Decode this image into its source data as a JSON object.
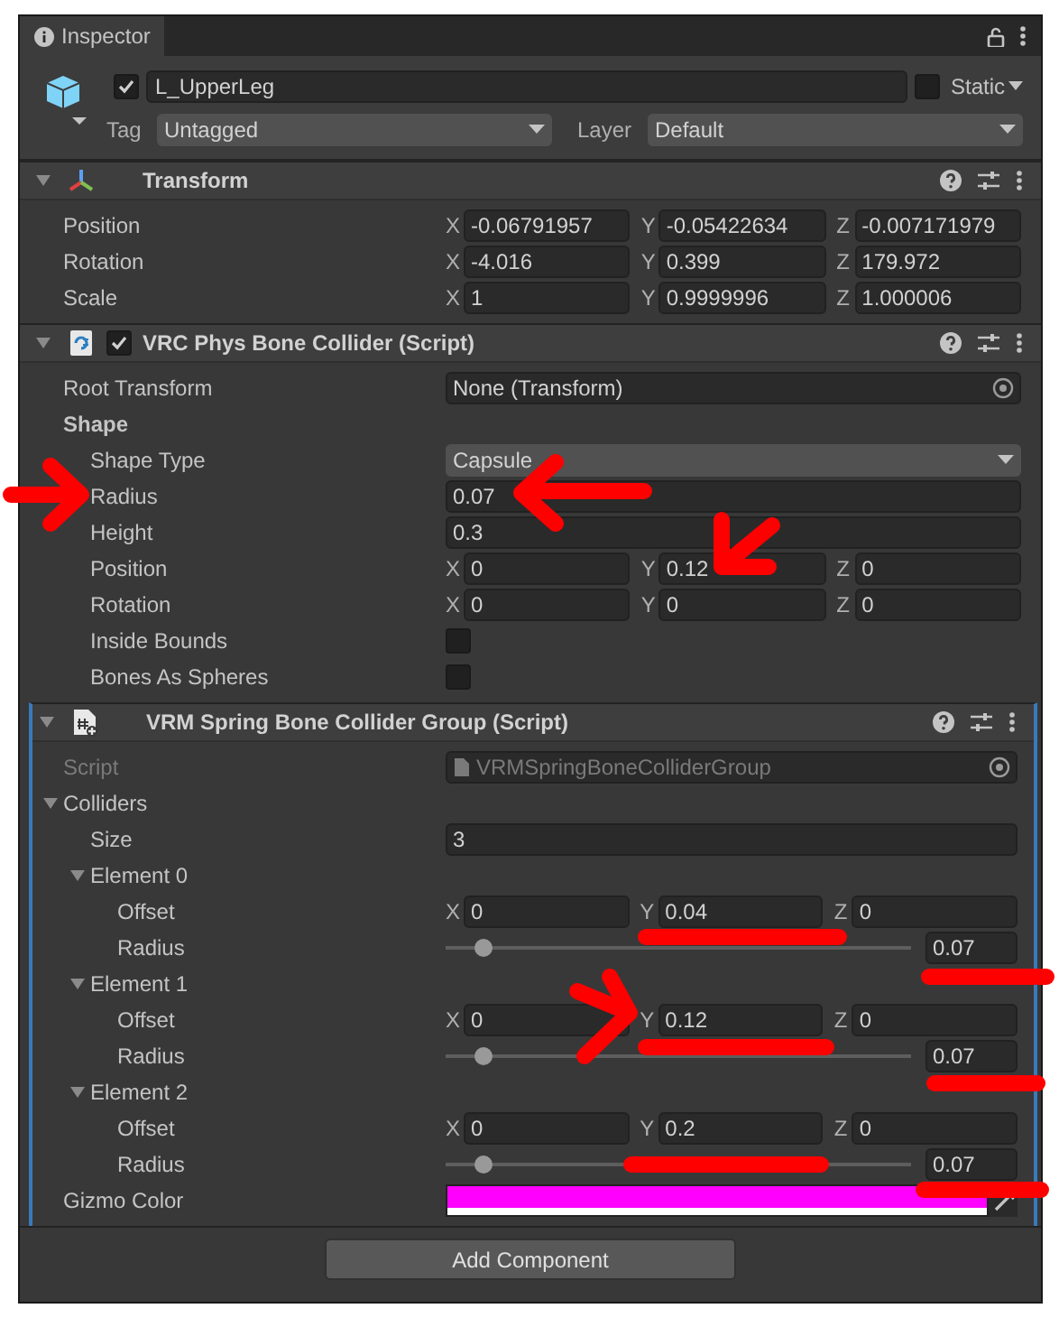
{
  "tab": {
    "label": "Inspector"
  },
  "object": {
    "active": true,
    "name": "L_UpperLeg",
    "static": false,
    "static_label": "Static",
    "tag_label": "Tag",
    "tag": "Untagged",
    "layer_label": "Layer",
    "layer": "Default"
  },
  "components": [
    {
      "kind": "transform",
      "title": "Transform",
      "expanded": true,
      "highlighted": false,
      "rows": [
        {
          "kind": "vector",
          "label": "Position",
          "axes": [
            {
              "axis": "X",
              "value": "-0.06791957"
            },
            {
              "axis": "Y",
              "value": "-0.05422634"
            },
            {
              "axis": "Z",
              "value": "-0.007171979"
            }
          ]
        },
        {
          "kind": "vector",
          "label": "Rotation",
          "axes": [
            {
              "axis": "X",
              "value": "-4.016"
            },
            {
              "axis": "Y",
              "value": "0.399"
            },
            {
              "axis": "Z",
              "value": "179.972"
            }
          ]
        },
        {
          "kind": "vector",
          "label": "Scale",
          "axes": [
            {
              "axis": "X",
              "value": "1"
            },
            {
              "axis": "Y",
              "value": "0.9999996"
            },
            {
              "axis": "Z",
              "value": "1.000006"
            }
          ]
        }
      ]
    },
    {
      "kind": "script",
      "title": "VRC Phys Bone Collider (Script)",
      "expanded": true,
      "enabled": true,
      "highlighted": false,
      "rows": [
        {
          "kind": "object",
          "label": "Root Transform",
          "value": "None (Transform)",
          "disabled": false
        },
        {
          "kind": "header",
          "label": "Shape",
          "children": [
            {
              "kind": "dropdown",
              "label": "Shape Type",
              "value": "Capsule"
            },
            {
              "kind": "text",
              "label": "Radius",
              "value": "0.07"
            },
            {
              "kind": "text",
              "label": "Height",
              "value": "0.3"
            },
            {
              "kind": "vector",
              "label": "Position",
              "axes": [
                {
                  "axis": "X",
                  "value": "0"
                },
                {
                  "axis": "Y",
                  "value": "0.12"
                },
                {
                  "axis": "Z",
                  "value": "0"
                }
              ]
            },
            {
              "kind": "vector",
              "label": "Rotation",
              "axes": [
                {
                  "axis": "X",
                  "value": "0"
                },
                {
                  "axis": "Y",
                  "value": "0"
                },
                {
                  "axis": "Z",
                  "value": "0"
                }
              ]
            },
            {
              "kind": "checkbox",
              "label": "Inside Bounds",
              "checked": false
            },
            {
              "kind": "checkbox",
              "label": "Bones As Spheres",
              "checked": false
            }
          ]
        }
      ]
    },
    {
      "kind": "script_new",
      "title": "VRM Spring Bone Collider Group (Script)",
      "expanded": true,
      "highlighted": true,
      "rows": [
        {
          "kind": "object",
          "label": "Script",
          "value": "VRMSpringBoneColliderGroup",
          "disabled": true
        },
        {
          "kind": "foldout",
          "label": "Colliders",
          "expanded": true,
          "children": [
            {
              "kind": "text",
              "label": "Size",
              "value": "3"
            },
            {
              "kind": "foldout",
              "label": "Element 0",
              "expanded": true,
              "children": [
                {
                  "kind": "vector",
                  "label": "Offset",
                  "axes": [
                    {
                      "axis": "X",
                      "value": "0"
                    },
                    {
                      "axis": "Y",
                      "value": "0.04"
                    },
                    {
                      "axis": "Z",
                      "value": "0"
                    }
                  ]
                },
                {
                  "kind": "slider",
                  "label": "Radius",
                  "level": 0.08,
                  "value": "0.07"
                }
              ]
            },
            {
              "kind": "foldout",
              "label": "Element 1",
              "expanded": true,
              "children": [
                {
                  "kind": "vector",
                  "label": "Offset",
                  "axes": [
                    {
                      "axis": "X",
                      "value": "0"
                    },
                    {
                      "axis": "Y",
                      "value": "0.12"
                    },
                    {
                      "axis": "Z",
                      "value": "0"
                    }
                  ]
                },
                {
                  "kind": "slider",
                  "label": "Radius",
                  "level": 0.08,
                  "value": "0.07"
                }
              ]
            },
            {
              "kind": "foldout",
              "label": "Element 2",
              "expanded": true,
              "children": [
                {
                  "kind": "vector",
                  "label": "Offset",
                  "axes": [
                    {
                      "axis": "X",
                      "value": "0"
                    },
                    {
                      "axis": "Y",
                      "value": "0.2"
                    },
                    {
                      "axis": "Z",
                      "value": "0"
                    }
                  ]
                },
                {
                  "kind": "slider",
                  "label": "Radius",
                  "level": 0.08,
                  "value": "0.07"
                }
              ]
            }
          ]
        },
        {
          "kind": "color",
          "label": "Gizmo Color",
          "color": "#ff00ff"
        }
      ]
    }
  ],
  "add_component": "Add Component",
  "annotations": [
    {
      "kind": "arrow"
    },
    {
      "kind": "arrow"
    },
    {
      "kind": "arrow"
    },
    {
      "kind": "arrow"
    },
    {
      "kind": "underline"
    },
    {
      "kind": "underline"
    },
    {
      "kind": "underline"
    },
    {
      "kind": "underline"
    },
    {
      "kind": "underline"
    },
    {
      "kind": "underline"
    }
  ]
}
